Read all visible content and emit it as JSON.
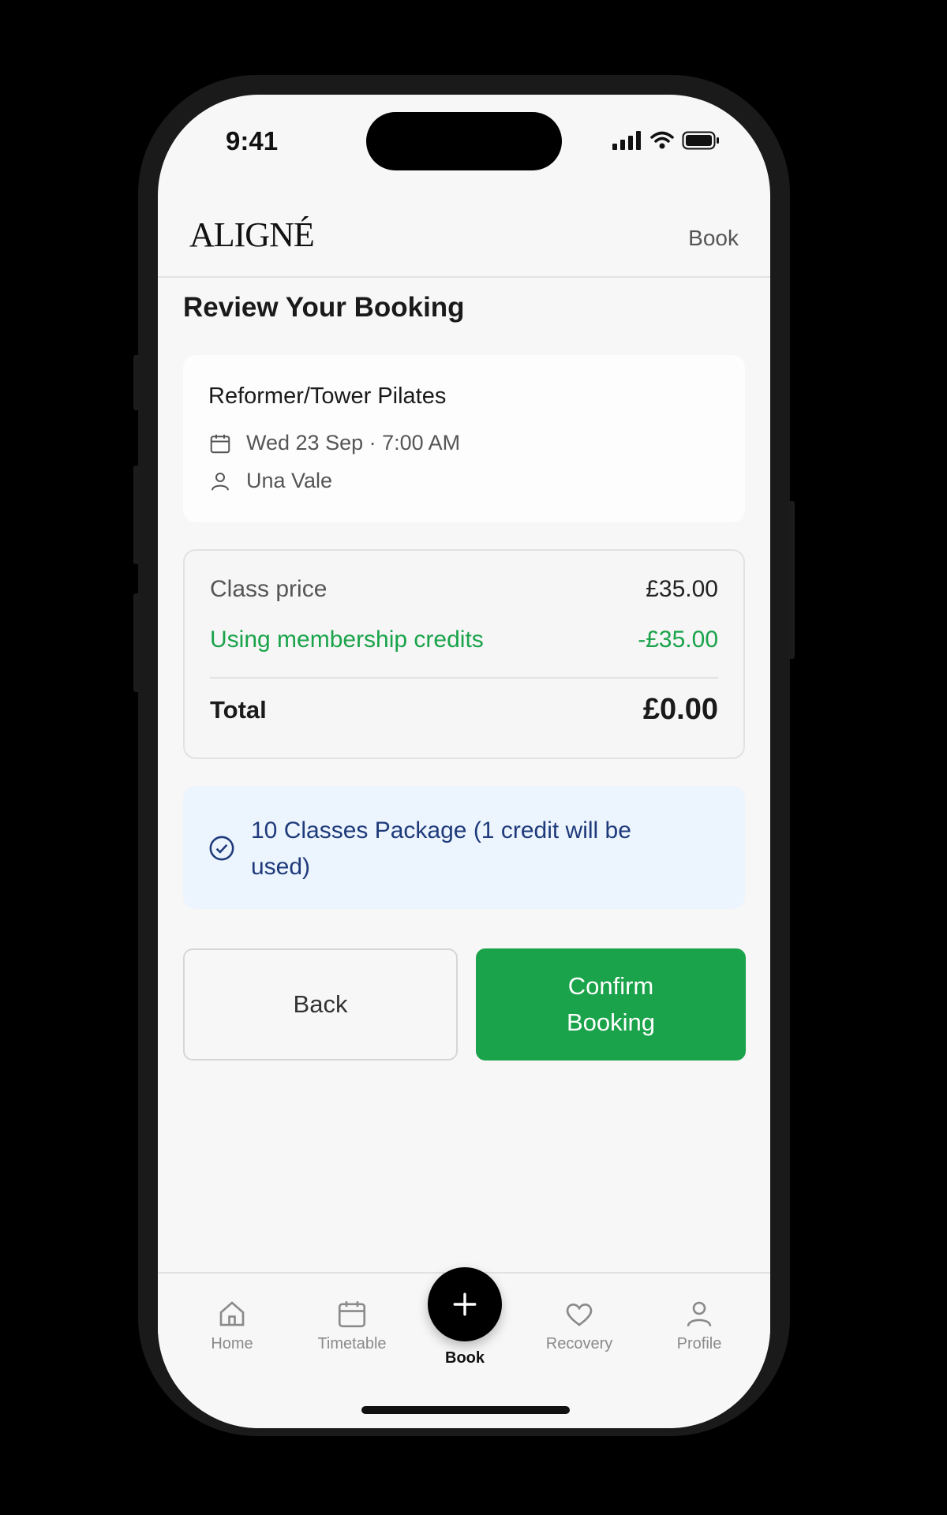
{
  "status_bar": {
    "time": "9:41"
  },
  "header": {
    "logo": "ALIGNÉ",
    "link": "Book"
  },
  "page": {
    "title": "Review Your Booking"
  },
  "booking": {
    "class_name": "Reformer/Tower Pilates",
    "datetime": "Wed 23 Sep · 7:00 AM",
    "instructor": "Una Vale"
  },
  "pricing": {
    "class_price_label": "Class price",
    "class_price_value": "£35.00",
    "credits_label": "Using membership credits",
    "credits_value": "-£35.00",
    "total_label": "Total",
    "total_value": "£0.00"
  },
  "package": {
    "text": "10 Classes Package (1 credit will be used)"
  },
  "actions": {
    "back_label": "Back",
    "confirm_label": "Confirm Booking"
  },
  "tabbar": {
    "items": [
      {
        "label": "Home",
        "icon": "home-icon"
      },
      {
        "label": "Timetable",
        "icon": "calendar-icon"
      },
      {
        "label": "Book",
        "icon": "plus-icon"
      },
      {
        "label": "Recovery",
        "icon": "heart-icon"
      },
      {
        "label": "Profile",
        "icon": "user-icon"
      }
    ]
  },
  "colors": {
    "accent_green": "#1aa34a",
    "info_bg": "#ecf4fd",
    "info_text": "#1e3a7a"
  }
}
